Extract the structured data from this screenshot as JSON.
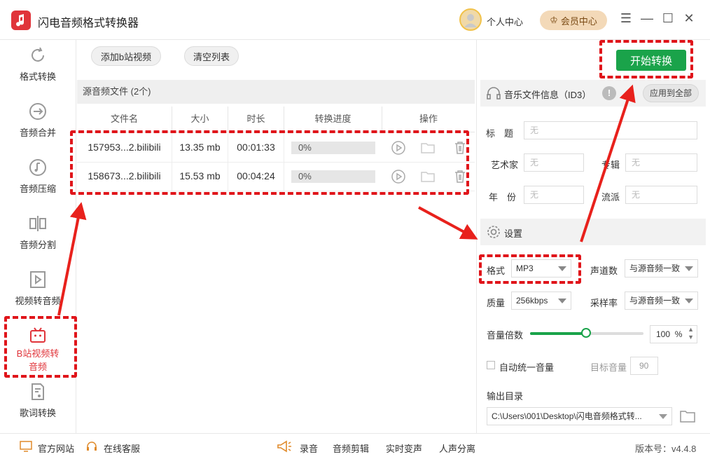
{
  "app": {
    "title": "闪电音频格式转换器",
    "user_center": "个人中心",
    "vip": "会员中心"
  },
  "sidebar": {
    "items": [
      {
        "label": "格式转换"
      },
      {
        "label": "音频合并"
      },
      {
        "label": "音频压缩"
      },
      {
        "label": "音频分割"
      },
      {
        "label": "视频转音频"
      },
      {
        "label": "B站视频转音频"
      },
      {
        "label": "歌词转换"
      }
    ]
  },
  "toolbar": {
    "add_bilibili": "添加b站视频",
    "clear_list": "清空列表",
    "start": "开始转换"
  },
  "files": {
    "header": "源音频文件 (2个)",
    "columns": [
      "文件名",
      "大小",
      "时长",
      "转换进度",
      "操作"
    ],
    "rows": [
      {
        "name": "157953...2.bilibili",
        "size": "13.35 mb",
        "duration": "00:01:33",
        "progress": "0%"
      },
      {
        "name": "158673...2.bilibili",
        "size": "15.53 mb",
        "duration": "00:04:24",
        "progress": "0%"
      }
    ]
  },
  "id3": {
    "title": "音乐文件信息（ID3）",
    "apply_all": "应用到全部",
    "fields": {
      "title": "标　题",
      "artist": "艺术家",
      "album": "专辑",
      "year": "年　份",
      "genre": "流派"
    },
    "placeholder": "无"
  },
  "settings": {
    "title": "设置",
    "format_label": "格式",
    "format_value": "MP3",
    "channel_label": "声道数",
    "channel_value": "与源音频一致",
    "quality_label": "质量",
    "quality_value": "256kbps",
    "samplerate_label": "采样率",
    "samplerate_value": "与源音频一致",
    "volume_label": "音量倍数",
    "volume_value": "100",
    "volume_unit": "%",
    "auto_volume_label": "自动统一音量",
    "target_volume_label": "目标音量",
    "target_volume_value": "90",
    "output_label": "输出目录",
    "output_path": "C:\\Users\\001\\Desktop\\闪电音频格式转..."
  },
  "bottom": {
    "website": "官方网站",
    "service": "在线客服",
    "record": "录音",
    "edit": "音频剪辑",
    "realtime": "实时变声",
    "separate": "人声分离",
    "version": "版本号：v4.4.8"
  },
  "colors": {
    "accent": "#e0343a",
    "green": "#1aa34a",
    "annotation": "#e0141a"
  }
}
